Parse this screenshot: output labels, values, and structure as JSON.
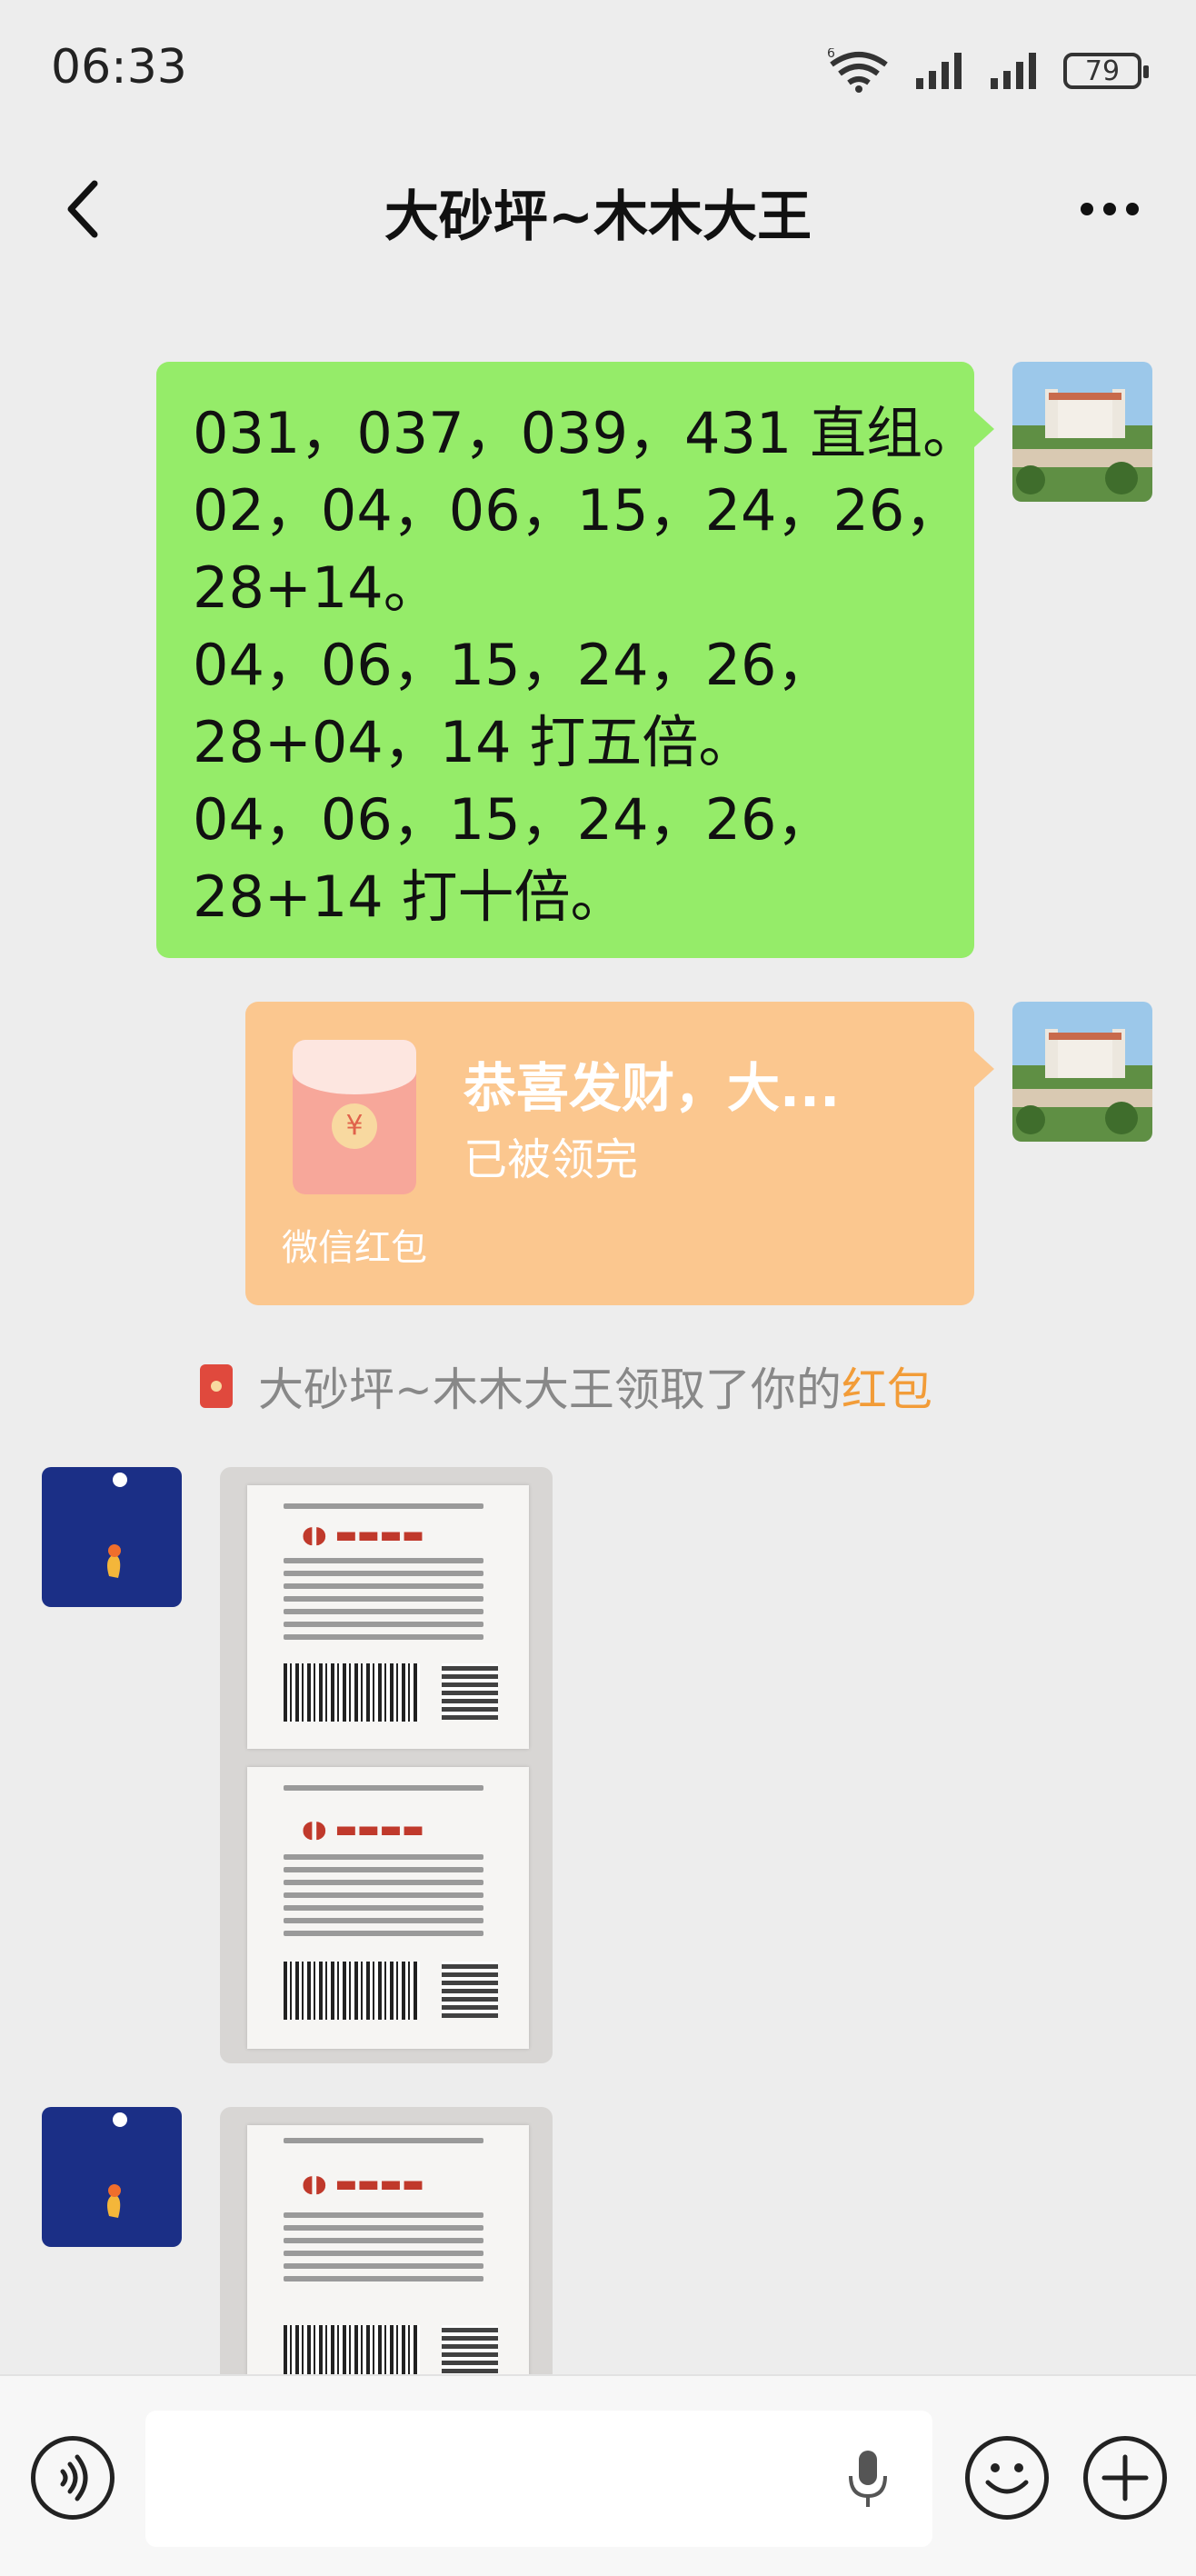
{
  "status_bar": {
    "time": "06:33",
    "network": "6",
    "battery": "79"
  },
  "header": {
    "title": "大砂坪~木木大王"
  },
  "messages": {
    "text_bubble": {
      "lines": [
        "031，037，039，431 直组。",
        "02，04，06，15，24，26，",
        "28+14。",
        "04，06，15，24，26，",
        "28+04，14 打五倍。",
        "04，06，15，24，26，",
        "28+14 打十倍。"
      ]
    },
    "red_packet": {
      "title": "恭喜发财，大...",
      "status": "已被领完",
      "footer": "微信红包",
      "coin": "¥"
    },
    "notice": {
      "prefix": "大砂坪~木木大王领取了你的",
      "highlight": "红包"
    }
  },
  "colors": {
    "self_bubble": "#95ec69",
    "red_packet": "#fbc78f",
    "notice_highlight": "#f29c38",
    "background": "#ededed"
  },
  "icons": {
    "back": "chevron-left-icon",
    "more": "more-dots-icon",
    "voice": "voice-icon",
    "mic": "mic-icon",
    "emoji": "emoji-icon",
    "plus": "plus-icon"
  }
}
